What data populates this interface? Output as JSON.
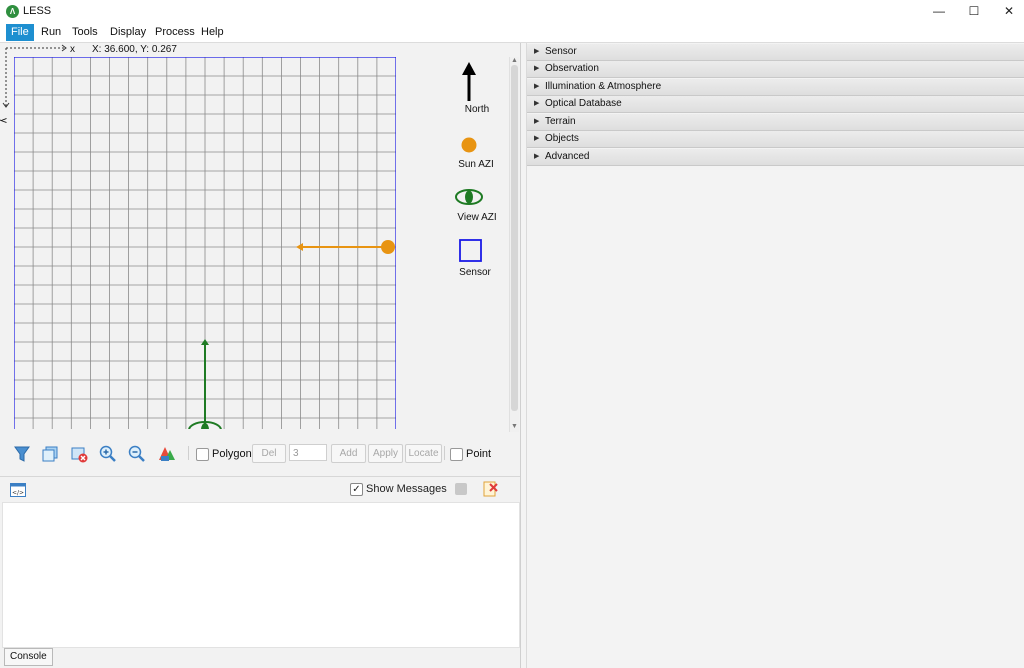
{
  "window": {
    "title": "LESS",
    "logo_letter": "Λ",
    "controls": {
      "minimize": "—",
      "maximize": "☐",
      "close": "✕"
    }
  },
  "menu": [
    "File",
    "Run",
    "Tools",
    "Display",
    "Process",
    "Help"
  ],
  "map": {
    "x_axis_label": "x",
    "y_axis_label": "y",
    "coord_readout": "X: 36.600, Y: 0.267"
  },
  "legend": {
    "north": "North",
    "sun": "Sun AZI",
    "view": "View AZI",
    "sensor": "Sensor"
  },
  "toolbar": {
    "polygon_label": "Polygon",
    "polygon_checked": false,
    "del_label": "Del",
    "vertex_count": "3",
    "add_label": "Add",
    "apply_label": "Apply",
    "locate_label": "Locate",
    "point_label": "Point",
    "point_checked": false
  },
  "messages": {
    "show_messages_label": "Show Messages",
    "show_messages_checked": true,
    "console_tab": "Console"
  },
  "sections": [
    "Sensor",
    "Observation",
    "Illumination & Atmosphere",
    "Optical Database",
    "Terrain",
    "Objects",
    "Advanced"
  ],
  "colors": {
    "sun": "#e89412",
    "view": "#1e7a23",
    "sensor_boundary": "#1a1ae6",
    "grid": "#8a8a8a",
    "active_menu": "#1e8fd0"
  }
}
